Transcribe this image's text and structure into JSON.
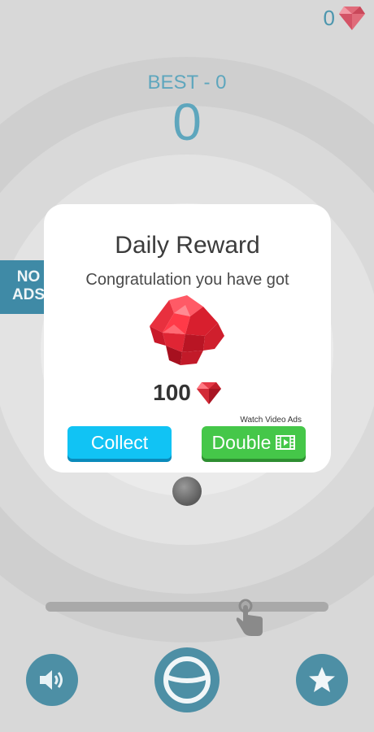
{
  "hud": {
    "gem_count": "0",
    "best_label": "BEST - 0",
    "score": "0"
  },
  "no_ads": {
    "label": "NO ADS"
  },
  "progress_track": {
    "position": 0.72
  },
  "bottom_bar": {
    "sound_icon": "speaker-icon",
    "play_icon": "ball-play-icon",
    "rate_icon": "star-icon"
  },
  "daily_reward": {
    "title": "Daily Reward",
    "subtitle": "Congratulation you have got",
    "amount": "100",
    "watch_label": "Watch Video Ads",
    "collect_label": "Collect",
    "double_label": "Double",
    "double_icon": "film-icon"
  },
  "colors": {
    "accent_blue": "#4d8fa5",
    "collect": "#11c3f4",
    "double": "#45c749",
    "gem_red": "#e53946"
  }
}
